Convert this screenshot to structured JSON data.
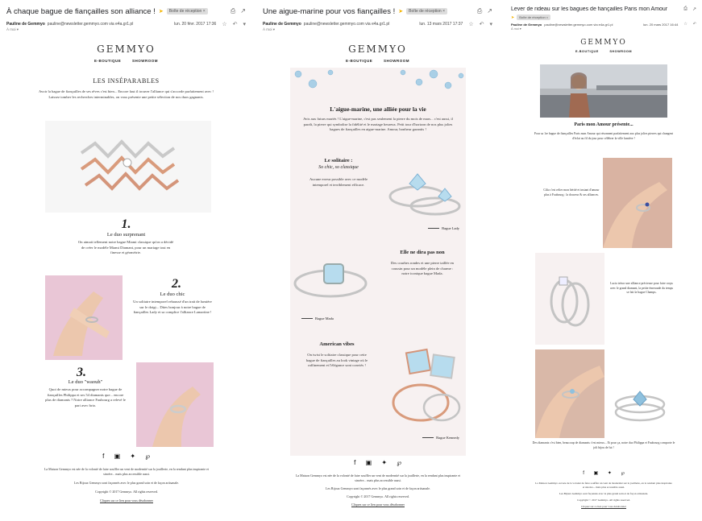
{
  "email1": {
    "subject": "À chaque bague de fiançailles son alliance !",
    "label": "Boîte de réception ×",
    "sender": "Pauline de Gemmyo",
    "sender_email": "pauline@newsletter.gemmyo.com via e4a.gr1.pl",
    "date": "lun. 20 févr. 2017 17:36",
    "to": "À moi ▾",
    "logo": "GEMMYO",
    "nav": [
      "E-BOUTIQUE",
      "SHOWROOM"
    ],
    "title": "LES INSÉPARABLES",
    "intro": "Avoir la bague de fiançailles de ses rêves c'est bien... Encore faut il trouver l'alliance qui s'accorde parfaitement avec ! Laissez tomber les recherches interminables, on vous présente une petite sélection de nos duos gagnants.",
    "duo1": {
      "num": "1.",
      "title": "Le duo surprenant",
      "text": "On aimait tellement notre bague Miami classique qu'on a décidé de créer le modèle Miami Diamant, pour un mariage tout en finesse et géométrie."
    },
    "duo2": {
      "num": "2.",
      "title": "Le duo chic",
      "text": "Un solitaire intemporel rehaussé d'un trait de lumière sur le doigt... Dites bonjour à notre bague de fiançailles Lady et sa complice l'alliance Lamartine !"
    },
    "duo3": {
      "num": "3.",
      "title": "Le duo \"waouh\"",
      "text": "Quoi de mieux pour accompagner notre bague de fiançailles Philippa et ses 54 diamants que... encore plus de diamants ? Notre alliance Faubourg a relevé le pari avec brio."
    },
    "footer1": "La Maison Gemmyo est née de la volonté de faire souffler un vent de modernité sur la joaillerie, en la rendant plus inspirante et sincère... mais plus accessible aussi.",
    "footer2": "Les Bijoux Gemmyo sont façonnés avec le plus grand soin et de façon artisanale.",
    "copyright": "Copyright © 2017 Gemmyo. All rights reserved.",
    "unsubscribe": "Cliquez sur ce lien pour vous désabonner"
  },
  "email2": {
    "subject": "Une aigue-marine pour vos fiançailles !",
    "label": "Boîte de réception ×",
    "sender": "Pauline de Gemmyo",
    "sender_email": "pauline@newsletter.gemmyo.com via e4a.gr1.pl",
    "date": "lun. 13 mars 2017 17:37",
    "to": "À moi ▾",
    "logo": "GEMMYO",
    "nav": [
      "E-BOUTIQUE",
      "SHOWROOM"
    ],
    "title": "L'aigue-marine, une alliée pour la vie",
    "intro": "Avis aux futurs mariés ! L'aigue-marine, c'est pas seulement la pierre du mois de mars... c'est aussi, il paraît, la pierre qui symbolise la fidélité et le mariage heureux. Petit tour d'horizon de nos plus jolies bagues de fiançailles en aigue-marine. Amour, bonheur garantis !",
    "s1_title": "Le solitaire :",
    "s1_sub": "So chic, so classique",
    "s1_text": "Aucune erreur possible avec ce modèle intemporel et terriblement efficace.",
    "s1_caption": "Bague Lady",
    "s2_title": "Elle ne dira pas non",
    "s2_text": "Des courbes rondes et une pierre taillée en coussin pour un modèle plein de charme : notre iconique bague Mada.",
    "s2_caption": "Bague Mada",
    "s3_title": "American vibes",
    "s3_text": "On twist le solitaire classique pour cette bague de fiançailles au look vintage où le raffinement et l'élégance sont conviés !",
    "s3_caption": "Bague Kennedy",
    "footer1": "La Maison Gemmyo est née de la volonté de faire souffler un vent de modernité sur la joaillerie, en la rendant plus inspirante et sincère... mais plus accessible aussi.",
    "footer2": "Les Bijoux Gemmyo sont façonnés avec le plus grand soin et de façon artisanale.",
    "copyright": "Copyright © 2017 Gemmyo. All rights reserved.",
    "unsubscribe": "Cliquez sur ce lien pour vous désabonner"
  },
  "email3": {
    "subject": "Lever de rideau sur les bagues de fiançailles Paris mon Amour",
    "label": "Boîte de réception ×",
    "sender": "Pauline de Gemmyo",
    "sender_email": "pauline@newsletter.gemmyo.com via e4a.gr1.pl",
    "date": "lun. 20 mars 2017 16:44",
    "to": "À moi ▾",
    "logo": "GEMMYO",
    "nav": [
      "E-BOUTIQUE",
      "SHOWROOM"
    ],
    "title": "Paris mon Amour présente...",
    "intro": "Pour sa 1re bague de fiançailles Paris mon Amour qui résonnent parfaitement aux plus jolies pierres qui changent d'éclat au fil du jour pour célébrer la ville lumière !",
    "t1": "Cilia c'est relier mon hérité et instant d'amour plus à Faubourg : la douceur & ses alliances.",
    "t2": "Lucia trésor une alliance précieuse pour faire corps avec le grand diamant, la petite émeraude du temps se fait la bague Champs.",
    "t3": "Des diamants c'est bien, beaucoup de diamants c'est mieux... Et pour ça, notre duo Philippa et Faubourg comporte le joli bijou de lui !",
    "footer1": "La Maison Gemmyo est née de la volonté de faire souffler un vent de modernité sur la joaillerie, en la rendant plus inspirante et sincère... mais plus accessible aussi.",
    "footer2": "Les Bijoux Gemmyo sont façonnés avec le plus grand soin et de façon artisanale.",
    "copyright": "Copyright © 2017 Gemmyo. All rights reserved.",
    "unsubscribe": "Cliquez sur ce lien pour vous désabonner"
  },
  "icons": {
    "print": "print-icon",
    "newwin": "open-new-window-icon",
    "star": "star-icon",
    "reply": "reply-icon",
    "more": "more-icon",
    "facebook": "facebook-icon",
    "instagram": "instagram-icon",
    "twitter": "twitter-icon",
    "pinterest": "pinterest-icon"
  },
  "colors": {
    "pink_bg": "#e9c6d6",
    "light_pink": "#f7f1f1",
    "highlight": "#f7eaa0",
    "label_gold": "#f4b400"
  }
}
